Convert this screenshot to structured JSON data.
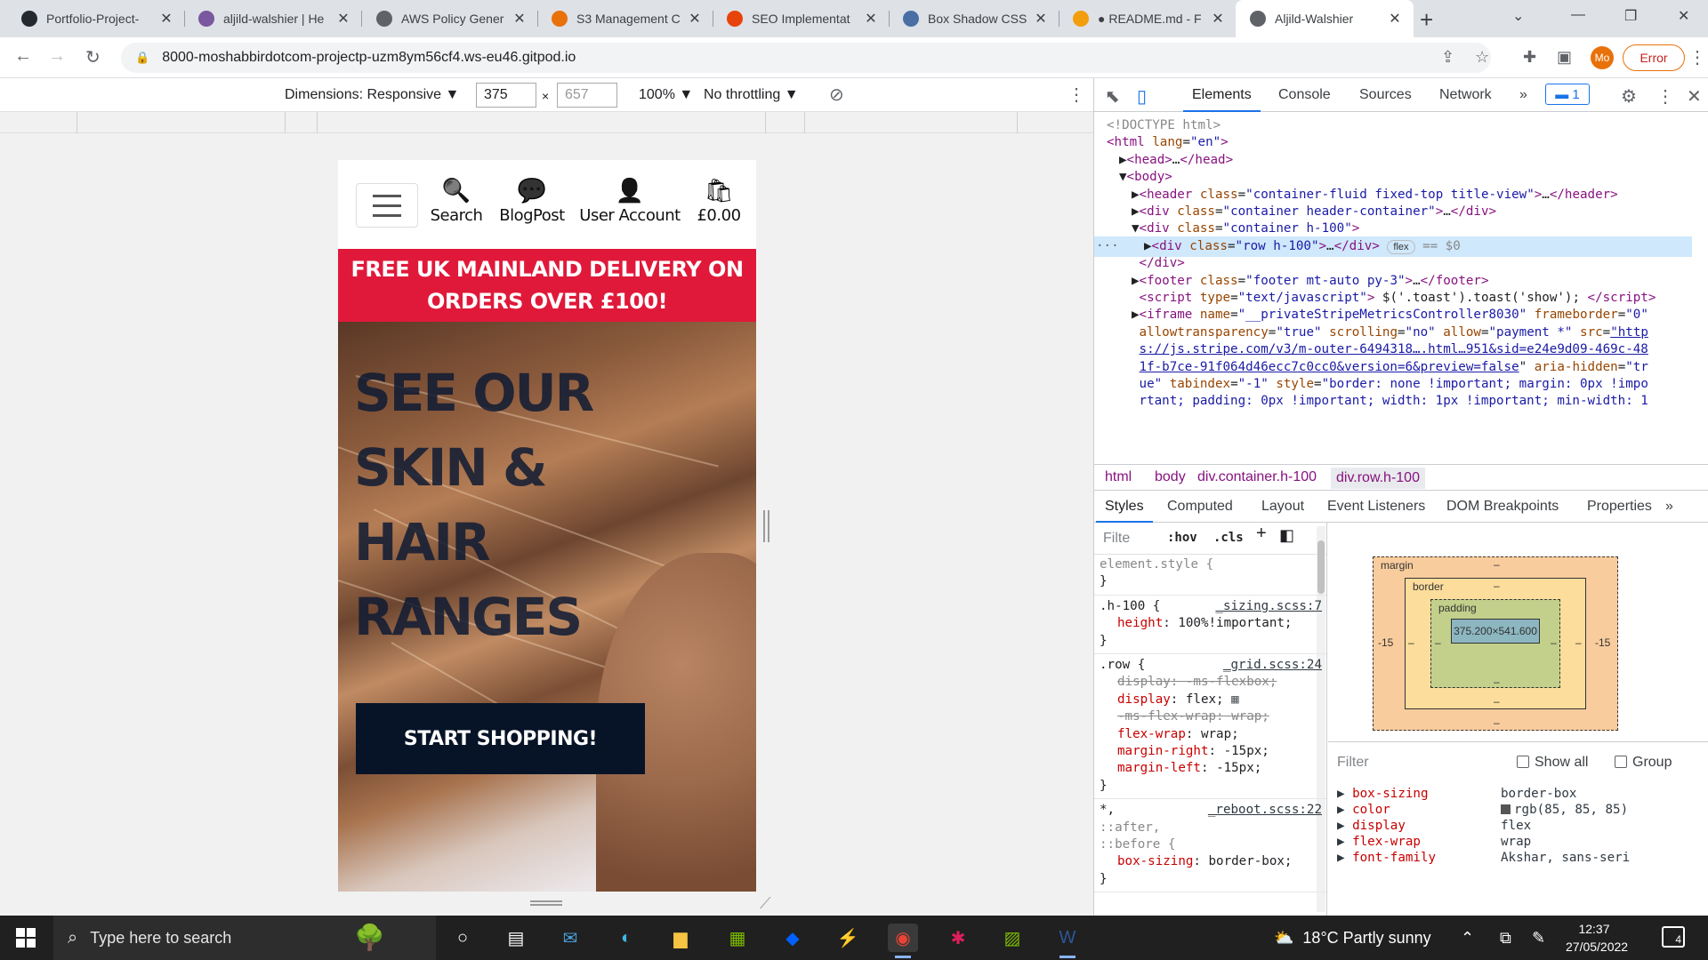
{
  "browser": {
    "tabs": [
      {
        "title": "Portfolio-Project-",
        "icon": "github-icon",
        "color": "#24292f"
      },
      {
        "title": "aljild-walshier | He",
        "icon": "heroku-icon",
        "color": "#79589f"
      },
      {
        "title": "AWS Policy Gener",
        "icon": "globe-icon",
        "color": "#5f6368"
      },
      {
        "title": "S3 Management C",
        "icon": "aws-s3-icon",
        "color": "#e8710a"
      },
      {
        "title": "SEO Implementat",
        "icon": "seo-icon",
        "color": "#e8430a"
      },
      {
        "title": "Box Shadow CSS",
        "icon": "css-icon",
        "color": "#4a6fa5"
      },
      {
        "title": "● README.md - F",
        "icon": "gitpod-icon",
        "color": "#f29e0c"
      },
      {
        "title": "Aljild-Walshier",
        "icon": "globe-icon",
        "color": "#5f6368",
        "active": true
      }
    ],
    "url": "8000-moshabbirdotcom-projectp-uzm8ym56cf4.ws-eu46.gitpod.io",
    "profile_initials": "Mo",
    "error_label": "Error"
  },
  "device_toolbar": {
    "dimensions_label": "Dimensions: Responsive ▼",
    "width": "375",
    "times": "×",
    "height": "657",
    "zoom": "100% ▼",
    "throttling": "No throttling ▼"
  },
  "site": {
    "nav": [
      {
        "label": "Search",
        "icon": "search-icon"
      },
      {
        "label": "BlogPost",
        "icon": "chat-icon"
      },
      {
        "label": "User Account",
        "icon": "user-icon"
      },
      {
        "label": "£0.00",
        "icon": "shopping-bag-icon"
      }
    ],
    "banner_line1": "FREE UK MAINLAND DELIVERY ON",
    "banner_line2": "ORDERS OVER £100!",
    "hero_lines": [
      "SEE OUR",
      "SKIN &",
      "HAIR",
      "RANGES"
    ],
    "cta": "START SHOPPING!",
    "colors": {
      "banner": "#e0193a",
      "cta": "#071427",
      "hero_text": "#0f1b33"
    }
  },
  "devtools": {
    "tabs": [
      "Elements",
      "Console",
      "Sources",
      "Network"
    ],
    "more": "»",
    "issues_count": "1",
    "dom_lines": [
      {
        "indent": 0,
        "html": "<span class='cm'>&lt;!DOCTYPE html&gt;</span>"
      },
      {
        "indent": 0,
        "html": "<span class='tag'>&lt;html</span> <span class='an'>lang</span>=<span class='av'>\"en\"</span><span class='tag'>&gt;</span>"
      },
      {
        "indent": 1,
        "html": "▶<span class='tag'>&lt;head&gt;</span>…<span class='tag'>&lt;/head&gt;</span>"
      },
      {
        "indent": 1,
        "html": "▼<span class='tag'>&lt;body&gt;</span>"
      },
      {
        "indent": 2,
        "html": "▶<span class='tag'>&lt;header</span> <span class='an'>class</span>=<span class='av'>\"container-fluid fixed-top title-view\"</span><span class='tag'>&gt;</span>…<span class='tag'>&lt;/header&gt;</span>"
      },
      {
        "indent": 2,
        "html": "▶<span class='tag'>&lt;div</span> <span class='an'>class</span>=<span class='av'>\"container header-container\"</span><span class='tag'>&gt;</span>…<span class='tag'>&lt;/div&gt;</span>"
      },
      {
        "indent": 2,
        "html": "▼<span class='tag'>&lt;div</span> <span class='an'>class</span>=<span class='av'>\"container h-100\"</span><span class='tag'>&gt;</span>"
      },
      {
        "indent": 3,
        "sel": true,
        "html": "▶<span class='tag'>&lt;div</span> <span class='an'>class</span>=<span class='av'>\"row h-100\"</span><span class='tag'>&gt;</span>…<span class='tag'>&lt;/div&gt;</span> <span class='badge'>flex</span> <span class='cm'>== $0</span>"
      },
      {
        "indent": 2,
        "html": "&nbsp;<span class='tag'>&lt;/div&gt;</span>"
      },
      {
        "indent": 2,
        "html": "▶<span class='tag'>&lt;footer</span> <span class='an'>class</span>=<span class='av'>\"footer mt-auto py-3\"</span><span class='tag'>&gt;</span>…<span class='tag'>&lt;/footer&gt;</span>"
      },
      {
        "indent": 2,
        "html": "&nbsp;<span class='tag'>&lt;script</span> <span class='an'>type</span>=<span class='av'>\"text/javascript\"</span><span class='tag'>&gt;</span> $('.toast').toast('show'); <span class='tag'>&lt;/script&gt;</span>"
      },
      {
        "indent": 2,
        "html": "▶<span class='tag'>&lt;iframe</span> <span class='an'>name</span>=<span class='av'>\"__privateStripeMetricsController8030\"</span> <span class='an'>frameborder</span>=<span class='av'>\"0\"</span>"
      },
      {
        "indent": 2,
        "html": "&nbsp;<span class='an'>allowtransparency</span>=<span class='av'>\"true\"</span> <span class='an'>scrolling</span>=<span class='av'>\"no\"</span> <span class='an'>allow</span>=<span class='av'>\"payment *\"</span> <span class='an'>src</span>=<span class='link'>\"http</span>"
      },
      {
        "indent": 2,
        "html": "&nbsp;<span class='link'>s://js.stripe.com/v3/m-outer-6494318….html…951&amp;sid=e24e9d09-469c-48</span>"
      },
      {
        "indent": 2,
        "html": "&nbsp;<span class='link'>1f-b7ce-91f064d46ecc7c0cc0&amp;version=6&amp;preview=false</span>\" <span class='an'>aria-hidden</span>=<span class='av'>\"tr</span>"
      },
      {
        "indent": 2,
        "html": "&nbsp;<span class='av'>ue\"</span> <span class='an'>tabindex</span>=<span class='av'>\"-1\"</span> <span class='an'>style</span>=<span class='av'>\"border: none !important; margin: 0px !impo</span>"
      },
      {
        "indent": 2,
        "html": "&nbsp;<span class='av'>rtant; padding: 0px !important; width: 1px !important; min-width: 1</span>"
      }
    ],
    "breadcrumbs": [
      "html",
      "body",
      "div.container.h-100",
      "div.row.h-100"
    ],
    "subtabs": [
      "Styles",
      "Computed",
      "Layout",
      "Event Listeners",
      "DOM Breakpoints",
      "Properties",
      "»"
    ],
    "styles_filter": "Filte",
    "hov": ":hov",
    "cls": ".cls",
    "rules": [
      {
        "selector": "element.style {",
        "source": "",
        "props": [],
        "close": "}"
      },
      {
        "selector": ".h-100 {",
        "source": "_sizing.scss:7",
        "props": [
          {
            "n": "height",
            "v": "100%!important;"
          }
        ],
        "close": "}"
      },
      {
        "selector": ".row {",
        "source": "_grid.scss:24",
        "props": [
          {
            "n": "display",
            "v": "-ms-flexbox;",
            "strike": true
          },
          {
            "n": "display",
            "v": "flex;"
          },
          {
            "n": "-ms-flex-wrap",
            "v": "wrap;",
            "strike": true
          },
          {
            "n": "flex-wrap",
            "v": "wrap;"
          },
          {
            "n": "margin-right",
            "v": "-15px;"
          },
          {
            "n": "margin-left",
            "v": "-15px;"
          }
        ],
        "close": "}"
      },
      {
        "selector": "*,",
        "selector2": "::after,",
        "selector3": "::before {",
        "source": "_reboot.scss:22",
        "props": [
          {
            "n": "box-sizing",
            "v": "border-box;"
          }
        ],
        "close": "}"
      }
    ],
    "box_model": {
      "margin": "margin",
      "border": "border",
      "padding": "padding",
      "content": "375.200×541.600",
      "dash": "–",
      "margin_left": "-15",
      "margin_right": "-15"
    },
    "computed": {
      "filter": "Filter",
      "show_all": "Show all",
      "group": "Group",
      "rows": [
        {
          "n": "box-sizing",
          "v": "border-box"
        },
        {
          "n": "color",
          "v": "rgb(85, 85, 85)",
          "swatch": "#555555"
        },
        {
          "n": "display",
          "v": "flex"
        },
        {
          "n": "flex-wrap",
          "v": "wrap"
        },
        {
          "n": "font-family",
          "v": "Akshar, sans-seri"
        }
      ]
    }
  },
  "taskbar": {
    "search_placeholder": "Type here to search",
    "weather": "18°C  Partly sunny",
    "time": "12:37",
    "date": "27/05/2022",
    "notifications": "4"
  }
}
